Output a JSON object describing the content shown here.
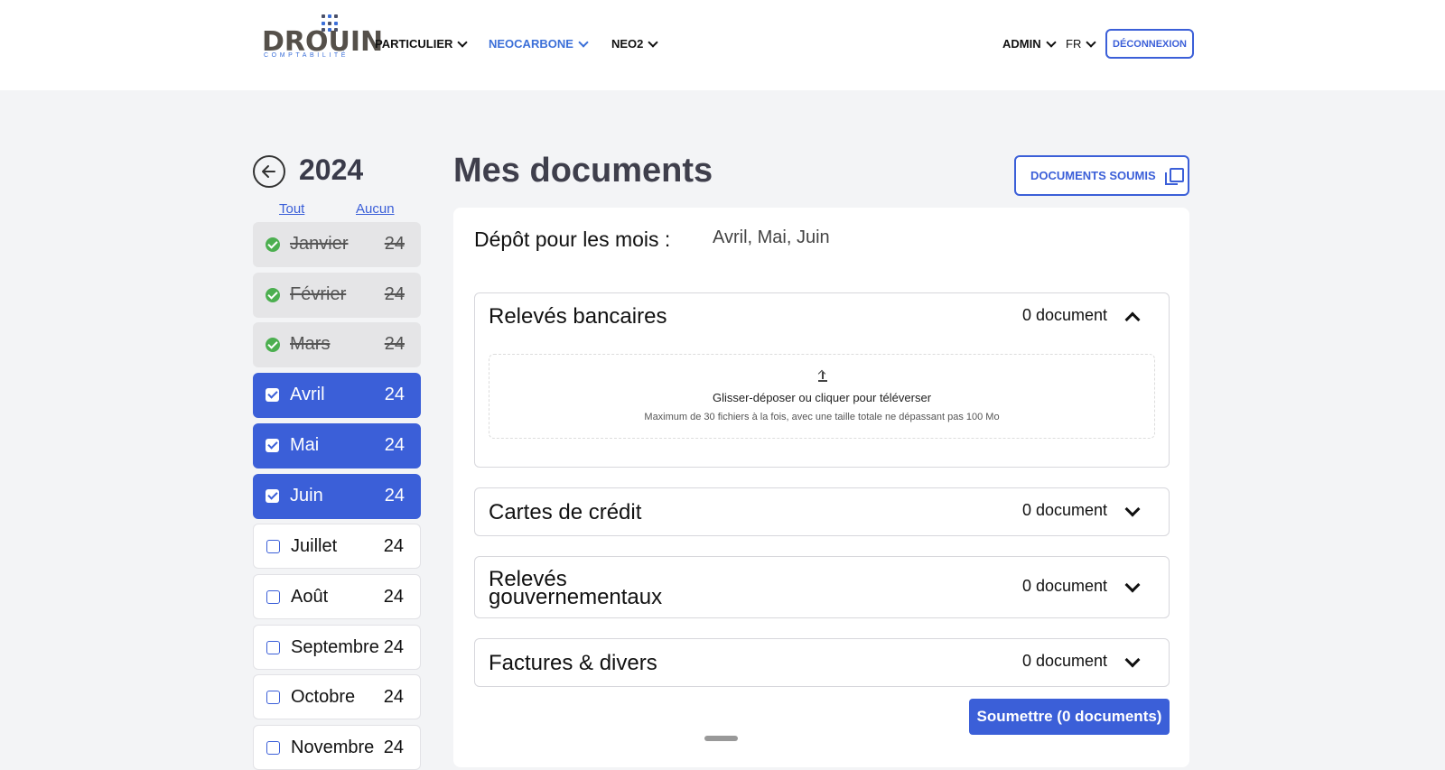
{
  "header": {
    "logo_word": "DROUIN",
    "logo_sub": "COMPTABILITÉ",
    "nav": [
      {
        "label": "PARTICULIER"
      },
      {
        "label": "NEOCARBONE"
      },
      {
        "label": "NEO2"
      }
    ],
    "admin_label": "ADMIN",
    "lang_label": "FR",
    "logout_label": "DÉCONNEXION",
    "accent_color": "#3b5fd8"
  },
  "sidebar": {
    "year": "2024",
    "select_all": "Tout",
    "select_none": "Aucun",
    "months": [
      {
        "name": "Janvier",
        "year": "24",
        "state": "done"
      },
      {
        "name": "Février",
        "year": "24",
        "state": "done"
      },
      {
        "name": "Mars",
        "year": "24",
        "state": "done"
      },
      {
        "name": "Avril",
        "year": "24",
        "state": "selected"
      },
      {
        "name": "Mai",
        "year": "24",
        "state": "selected"
      },
      {
        "name": "Juin",
        "year": "24",
        "state": "selected"
      },
      {
        "name": "Juillet",
        "year": "24",
        "state": "open"
      },
      {
        "name": "Août",
        "year": "24",
        "state": "open"
      },
      {
        "name": "Septembre",
        "year": "24",
        "state": "open"
      },
      {
        "name": "Octobre",
        "year": "24",
        "state": "open"
      },
      {
        "name": "Novembre",
        "year": "24",
        "state": "open"
      }
    ]
  },
  "main": {
    "title": "Mes documents",
    "submitted_button": "DOCUMENTS SOUMIS",
    "depot_label": "Dépôt pour les mois :",
    "depot_value": "Avril, Mai, Juin",
    "sections": [
      {
        "title": "Relevés bancaires",
        "count": "0 document",
        "expanded": true
      },
      {
        "title": "Cartes de crédit",
        "count": "0 document",
        "expanded": false
      },
      {
        "title": "Relevés gouvernementaux",
        "count": "0 document",
        "expanded": false
      },
      {
        "title": "Factures & divers",
        "count": "0 document",
        "expanded": false
      }
    ],
    "dropzone": {
      "main_text": "Glisser-déposer ou cliquer pour téléverser",
      "sub_text": "Maximum de 30 fichiers à la fois, avec une taille totale ne dépassant pas 100 Mo"
    },
    "submit_button": "Soumettre (0 documents)"
  }
}
